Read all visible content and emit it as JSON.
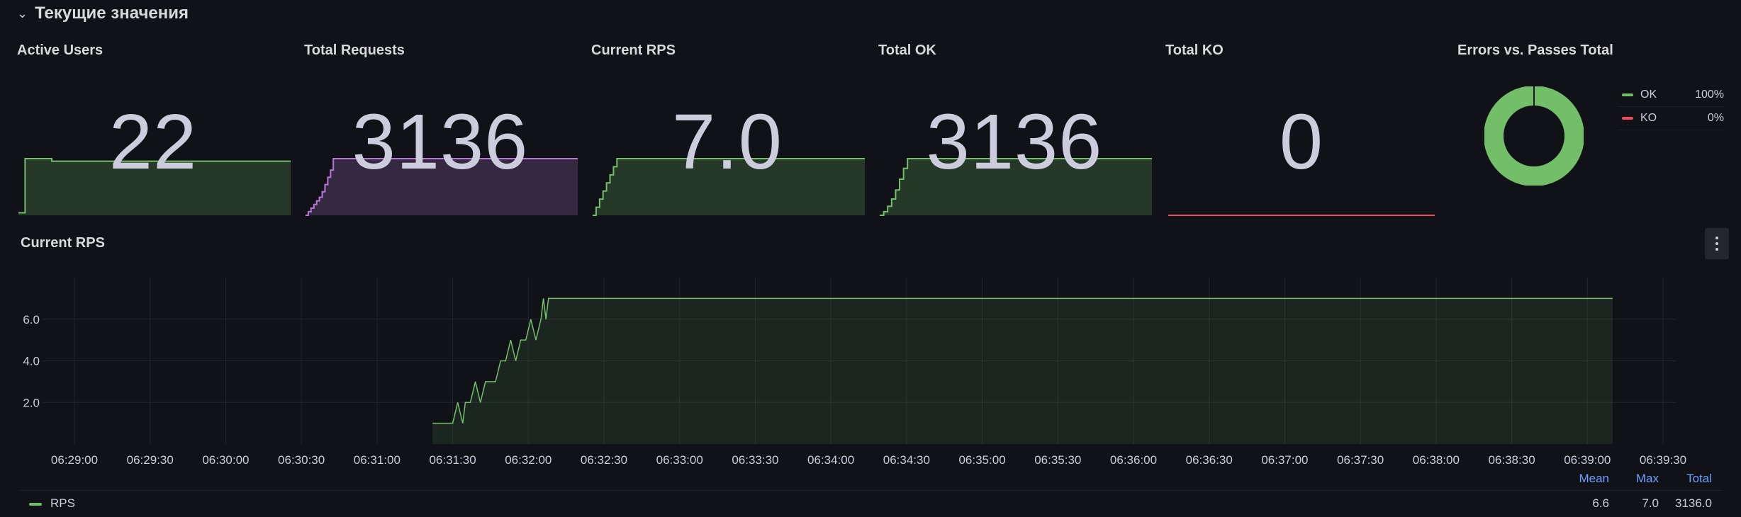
{
  "row": {
    "chevron": "⌄",
    "title": "Текущие значения"
  },
  "panels": {
    "active_users": {
      "title": "Active Users",
      "value": "22",
      "color": "#73bf69"
    },
    "total_requests": {
      "title": "Total Requests",
      "value": "3136",
      "color": "#b877d9"
    },
    "current_rps": {
      "title": "Current RPS",
      "value": "7.0",
      "color": "#73bf69"
    },
    "total_ok": {
      "title": "Total OK",
      "value": "3136",
      "color": "#73bf69"
    },
    "total_ko": {
      "title": "Total KO",
      "value": "0",
      "color": "#f2495c"
    }
  },
  "donut": {
    "title": "Errors vs. Passes Total",
    "items": [
      {
        "label": "OK",
        "pct": "100%",
        "fraction": 1.0,
        "color": "#73bf69"
      },
      {
        "label": "KO",
        "pct": "0%",
        "fraction": 0.0,
        "color": "#f2495c"
      }
    ]
  },
  "timeseries": {
    "title": "Current RPS",
    "menu_icon": "kebab-menu-icon",
    "legend": {
      "headers": {
        "mean": "Mean",
        "max": "Max",
        "total": "Total"
      },
      "series": {
        "name": "RPS",
        "mean": "6.6",
        "max": "7.0",
        "total": "3136.0",
        "color": "#73bf69"
      }
    }
  },
  "chart_data": {
    "type": "area",
    "title": "Current RPS",
    "x_tick_labels": [
      "06:29:00",
      "06:29:30",
      "06:30:00",
      "06:30:30",
      "06:31:00",
      "06:31:30",
      "06:32:00",
      "06:32:30",
      "06:33:00",
      "06:33:30",
      "06:34:00",
      "06:34:30",
      "06:35:00",
      "06:35:30",
      "06:36:00",
      "06:36:30",
      "06:37:00",
      "06:37:30",
      "06:38:00",
      "06:38:30",
      "06:39:00",
      "06:39:30"
    ],
    "y_tick_labels": [
      "2.0",
      "4.0",
      "6.0"
    ],
    "ylim": [
      0,
      8
    ],
    "grid": true,
    "legend_placement": "bottom",
    "series": [
      {
        "name": "RPS",
        "color": "#73bf69",
        "x": [
          "06:31:22",
          "06:31:30",
          "06:31:32",
          "06:31:34",
          "06:31:35",
          "06:31:37",
          "06:31:39",
          "06:31:41",
          "06:31:43",
          "06:31:45",
          "06:31:47",
          "06:31:49",
          "06:31:51",
          "06:31:53",
          "06:31:55",
          "06:31:57",
          "06:31:59",
          "06:32:01",
          "06:32:03",
          "06:32:05",
          "06:32:06",
          "06:32:07",
          "06:32:08",
          "06:32:30",
          "06:33:00",
          "06:34:00",
          "06:35:00",
          "06:36:00",
          "06:37:00",
          "06:38:00",
          "06:39:00",
          "06:39:10"
        ],
        "y": [
          1,
          1,
          2,
          1,
          2,
          2,
          3,
          2,
          3,
          3,
          3,
          4,
          4,
          5,
          4,
          5,
          5,
          6,
          5,
          6,
          7,
          6,
          7,
          7,
          7,
          7,
          7,
          7,
          7,
          7,
          7,
          7
        ]
      }
    ],
    "sparklines": {
      "active_users": [
        1,
        22,
        22,
        22,
        22,
        21
      ],
      "total_requests": [
        0,
        200,
        400,
        600,
        800,
        1000,
        1300,
        1700,
        2100,
        2500,
        3136
      ],
      "current_rps": [
        0,
        1,
        2,
        3,
        4,
        5,
        6,
        7,
        7
      ],
      "total_ok": [
        0,
        200,
        500,
        900,
        1400,
        2000,
        2600,
        3136
      ],
      "total_ko": [
        0,
        0,
        0,
        0
      ]
    }
  }
}
